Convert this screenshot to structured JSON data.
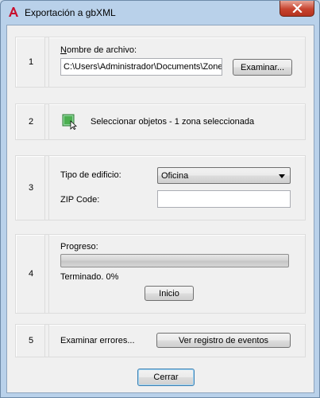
{
  "window": {
    "title": "Exportación a gbXML"
  },
  "sections": {
    "s1": {
      "number": "1",
      "file_label": "Nombre de archivo:",
      "file_value": "C:\\Users\\Administrador\\Documents\\Zones.xml",
      "browse_label": "Examinar..."
    },
    "s2": {
      "number": "2",
      "select_label": "Seleccionar objetos - 1 zona seleccionada"
    },
    "s3": {
      "number": "3",
      "building_type_label": "Tipo de edificio:",
      "building_type_value": "Oficina",
      "zip_label": "ZIP Code:",
      "zip_value": ""
    },
    "s4": {
      "number": "4",
      "progress_label": "Progreso:",
      "progress_value": 0,
      "status_text": "Terminado. 0%",
      "start_label": "Inicio"
    },
    "s5": {
      "number": "5",
      "errors_label": "Examinar errores...",
      "log_label": "Ver registro de eventos"
    }
  },
  "footer": {
    "close_label": "Cerrar"
  },
  "icons": {
    "app": "autocad-a-icon",
    "close": "close-icon",
    "select": "select-objects-icon",
    "dropdown": "chevron-down-icon"
  },
  "colors": {
    "app_icon": "#c8102e",
    "progress_fill": "#06b025"
  }
}
